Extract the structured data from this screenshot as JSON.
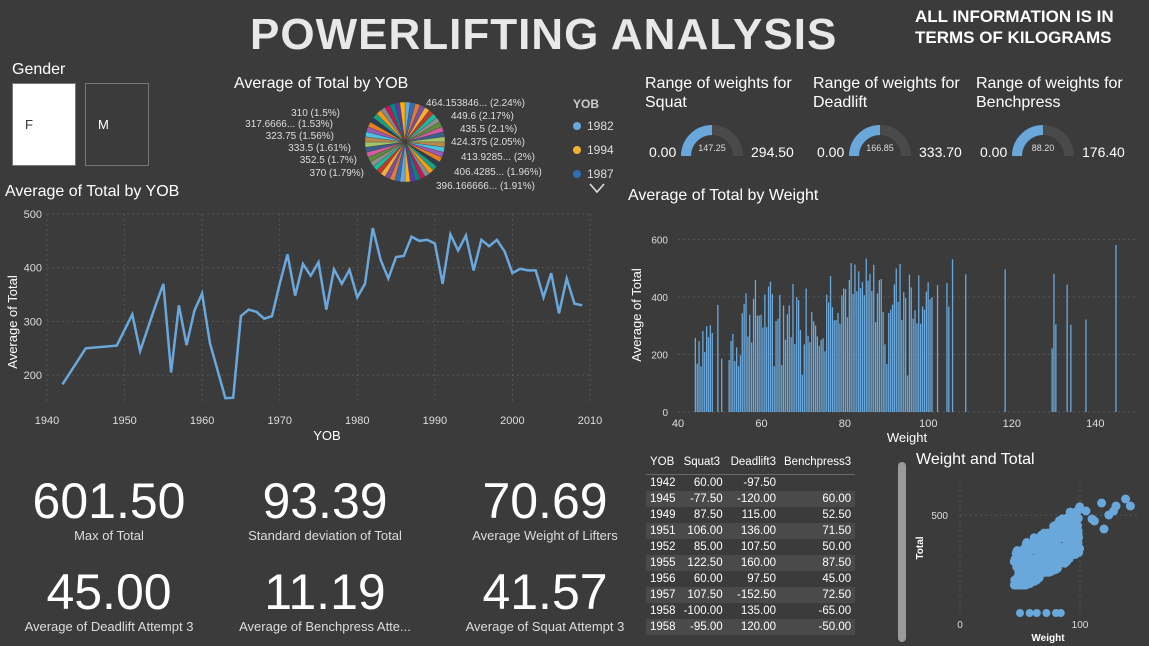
{
  "header": {
    "title": "POWERLIFTING ANALYSIS",
    "note_line1": "ALL INFORMATION IS IN",
    "note_line2": "TERMS OF KILOGRAMS"
  },
  "gender_slicer": {
    "label": "Gender",
    "options": [
      "F",
      "M"
    ],
    "selected": "F"
  },
  "colors": {
    "background": "#3b3b3b",
    "accent": "#6aa8dc",
    "gauge_track": "#4a4a4a"
  },
  "gauges": [
    {
      "title_line1": "Range of weights for",
      "title_line2": "Squat",
      "min": "0.00",
      "value": "147.25",
      "max": "294.50",
      "fraction": 0.5
    },
    {
      "title_line1": "Range of weights for",
      "title_line2": "Deadlift",
      "min": "0.00",
      "value": "166.85",
      "max": "333.70",
      "fraction": 0.5
    },
    {
      "title_line1": "Range of weights for",
      "title_line2": "Benchpress",
      "min": "0.00",
      "value": "88.20",
      "max": "176.40",
      "fraction": 0.5
    }
  ],
  "kpis": [
    {
      "value": "601.50",
      "label": "Max of Total"
    },
    {
      "value": "93.39",
      "label": "Standard deviation of Total"
    },
    {
      "value": "70.69",
      "label": "Average Weight of Lifters"
    },
    {
      "value": "45.00",
      "label": "Average of Deadlift Attempt 3"
    },
    {
      "value": "11.19",
      "label": "Average of Benchpress Atte..."
    },
    {
      "value": "41.57",
      "label": "Average of Squat Attempt 3"
    }
  ],
  "table": {
    "headers": [
      "YOB",
      "Squat3",
      "Deadlift3",
      "Benchpress3"
    ],
    "rows": [
      [
        "1942",
        "60.00",
        "-97.50",
        ""
      ],
      [
        "1945",
        "-77.50",
        "-120.00",
        "60.00"
      ],
      [
        "1949",
        "87.50",
        "115.00",
        "52.50"
      ],
      [
        "1951",
        "106.00",
        "136.00",
        "71.50"
      ],
      [
        "1952",
        "85.00",
        "107.50",
        "50.00"
      ],
      [
        "1955",
        "122.50",
        "160.00",
        "87.50"
      ],
      [
        "1956",
        "60.00",
        "97.50",
        "45.00"
      ],
      [
        "1957",
        "107.50",
        "-152.50",
        "72.50"
      ],
      [
        "1958",
        "-100.00",
        "135.00",
        "-65.00"
      ],
      [
        "1958",
        "-95.00",
        "120.00",
        "-50.00"
      ]
    ]
  },
  "chart_data": [
    {
      "type": "pie",
      "title": "Average of Total by YOB",
      "legend_title": "YOB",
      "legend_entries": [
        "1982",
        "1994",
        "1987"
      ],
      "legend_colors": [
        "#6aa8dc",
        "#f2b134",
        "#2f6eb5"
      ],
      "labels": [
        "464.153846... (2.24%)",
        "449.6 (2.17%)",
        "435.5 (2.1%)",
        "424.375 (2.05%)",
        "413.9285... (2%)",
        "406.4285... (1.96%)",
        "396.166666... (1.91%)",
        "370 (1.79%)",
        "352.5 (1.7%)",
        "333.5 (1.61%)",
        "323.75 (1.56%)",
        "317.6666... (1.53%)",
        "310 (1.5%)"
      ],
      "slice_count": 48
    },
    {
      "type": "line",
      "title": "Average of Total by YOB",
      "xlabel": "YOB",
      "ylabel": "Average of Total",
      "xlim": [
        1940,
        2010
      ],
      "ylim": [
        150,
        500
      ],
      "xticks": [
        "1940",
        "1950",
        "1960",
        "1970",
        "1980",
        "1990",
        "2000",
        "2010"
      ],
      "yticks": [
        "200",
        "300",
        "400",
        "500"
      ],
      "x": [
        1942,
        1945,
        1949,
        1951,
        1952,
        1954,
        1955,
        1956,
        1957,
        1958,
        1959,
        1960,
        1961,
        1963,
        1964,
        1965,
        1966,
        1967,
        1968,
        1969,
        1970,
        1971,
        1972,
        1973,
        1974,
        1975,
        1976,
        1977,
        1978,
        1979,
        1980,
        1981,
        1982,
        1983,
        1984,
        1985,
        1986,
        1987,
        1988,
        1989,
        1990,
        1991,
        1992,
        1993,
        1994,
        1995,
        1996,
        1997,
        1998,
        1999,
        2000,
        2001,
        2002,
        2003,
        2004,
        2005,
        2006,
        2007,
        2008,
        2009
      ],
      "y": [
        183,
        250,
        255,
        313,
        245,
        330,
        370,
        205,
        330,
        256,
        320,
        352,
        260,
        157,
        158,
        310,
        322,
        318,
        305,
        310,
        370,
        425,
        348,
        407,
        385,
        410,
        322,
        397,
        370,
        396,
        345,
        370,
        474,
        415,
        380,
        420,
        422,
        458,
        450,
        452,
        445,
        370,
        462,
        432,
        460,
        395,
        452,
        440,
        452,
        430,
        390,
        398,
        395,
        395,
        345,
        390,
        315,
        380,
        333,
        330,
        224
      ]
    },
    {
      "type": "bar",
      "title": "Average of Total by Weight",
      "xlabel": "Weight",
      "ylabel": "Average of Total",
      "xlim": [
        40,
        150
      ],
      "ylim": [
        0,
        650
      ],
      "xticks": [
        "40",
        "60",
        "80",
        "100",
        "120",
        "140"
      ],
      "yticks": [
        "0",
        "200",
        "400",
        "600"
      ]
    },
    {
      "type": "scatter",
      "title": "Weight and Total",
      "xlabel": "Weight",
      "ylabel": "Total",
      "xlim": [
        0,
        150
      ],
      "ylim": [
        0,
        650
      ],
      "xticks": [
        "0",
        "100"
      ],
      "yticks": [
        "500"
      ]
    }
  ]
}
